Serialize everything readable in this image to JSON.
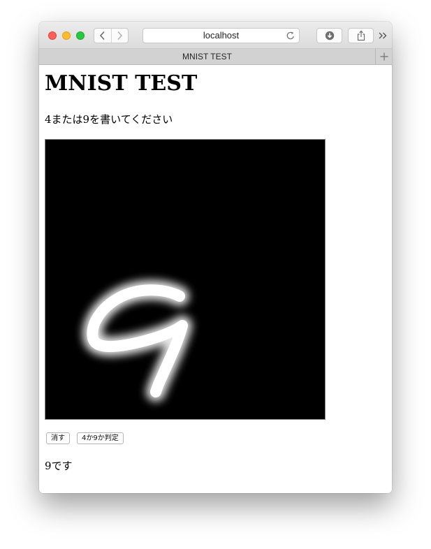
{
  "browser": {
    "url": "localhost",
    "tab_title": "MNIST TEST"
  },
  "page": {
    "heading": "MNIST TEST",
    "instruction": "4または9を書いてください",
    "canvas": {
      "background": "#000000",
      "stroke_color": "#ffffff"
    },
    "buttons": {
      "clear_label": "消す",
      "judge_label": "4か9か判定"
    },
    "result": "9です"
  },
  "icons": {
    "back": "chevron-left-icon",
    "forward": "chevron-right-icon",
    "reload": "reload-icon",
    "download": "download-icon",
    "share": "share-icon",
    "more": "double-chevron-right-icon",
    "new_tab": "plus-icon"
  }
}
